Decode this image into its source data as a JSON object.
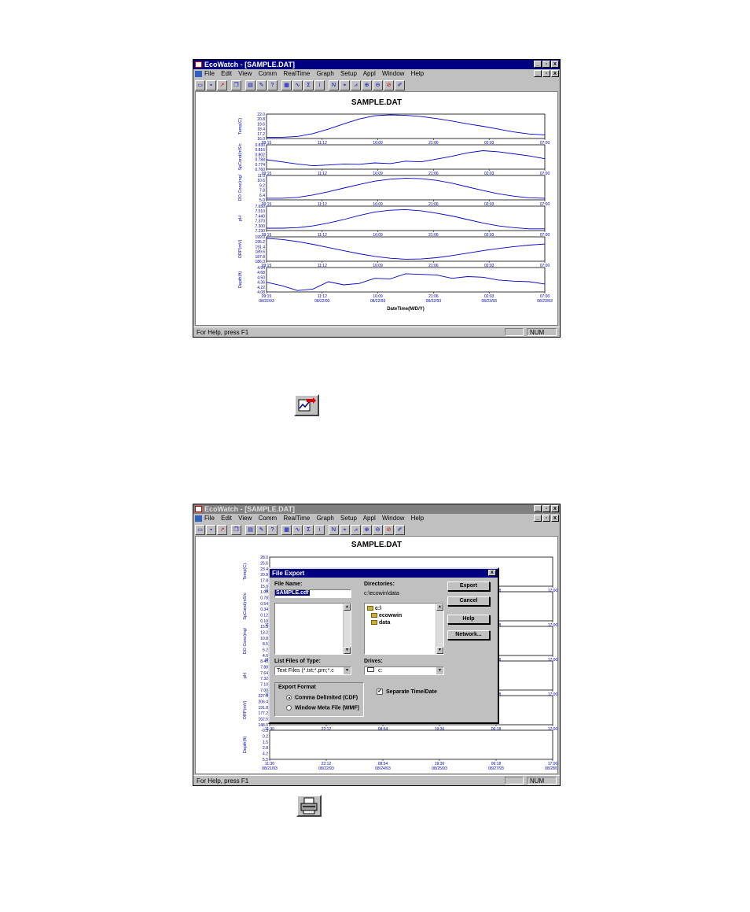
{
  "app": {
    "title": "EcoWatch - [SAMPLE.DAT]",
    "menu": [
      "File",
      "Edit",
      "View",
      "Comm",
      "RealTime",
      "Graph",
      "Setup",
      "Appl",
      "Window",
      "Help"
    ],
    "status_text": "For Help, press F1",
    "status_num": "NUM"
  },
  "plot1": {
    "title": "SAMPLE.DAT",
    "xlabel": "DateTime(M/D/Y)",
    "time_ticks": [
      "09:15",
      "11:12",
      "16:09",
      "21:06",
      "02:03",
      "07:00"
    ],
    "date_ticks": [
      "08/22/93",
      "08/22/93",
      "08/22/93",
      "08/22/93",
      "08/23/93",
      "08/23/93"
    ],
    "panels": [
      {
        "label": "Temp(C)",
        "ticks": [
          "22.0",
          "20.8",
          "19.6",
          "18.4",
          "17.2",
          "16.0"
        ],
        "values": [
          16.3,
          16.3,
          16.5,
          17.2,
          18.3,
          19.6,
          20.8,
          21.6,
          21.8,
          21.7,
          21.4,
          20.9,
          20.3,
          19.6,
          19.0,
          18.3,
          17.6,
          17.1,
          16.9
        ]
      },
      {
        "label": "SpCond(mS/c",
        "ticks": [
          "0.830",
          "0.816",
          "0.802",
          "0.788",
          "0.774",
          "0.760"
        ],
        "values": [
          0.787,
          0.781,
          0.775,
          0.77,
          0.772,
          0.775,
          0.774,
          0.778,
          0.776,
          0.783,
          0.781,
          0.789,
          0.797,
          0.807,
          0.813,
          0.81,
          0.804,
          0.798,
          0.79
        ]
      },
      {
        "label": "DO Conc(mg/",
        "ticks": [
          "11.0",
          "10.6",
          "9.2",
          "7.8",
          "6.4",
          "5.0"
        ],
        "values": [
          5.4,
          5.4,
          5.6,
          6.2,
          7.0,
          7.9,
          8.8,
          9.6,
          10.1,
          10.3,
          10.2,
          9.8,
          9.1,
          8.2,
          7.3,
          6.5,
          5.9,
          5.5,
          5.4
        ]
      },
      {
        "label": "pH",
        "ticks": [
          "7.650",
          "7.510",
          "7.440",
          "7.370",
          "7.300",
          "7.230"
        ],
        "values": [
          7.27,
          7.27,
          7.28,
          7.31,
          7.36,
          7.42,
          7.49,
          7.55,
          7.58,
          7.59,
          7.57,
          7.53,
          7.48,
          7.42,
          7.36,
          7.31,
          7.28,
          7.26,
          7.26
        ]
      },
      {
        "label": "ORP(mV)",
        "ticks": [
          "199.0",
          "195.2",
          "191.4",
          "189.6",
          "187.8",
          "186.0"
        ],
        "values": [
          198.2,
          197.6,
          196.5,
          195.0,
          193.3,
          191.6,
          190.0,
          188.6,
          187.6,
          187.1,
          187.2,
          187.9,
          189.0,
          190.3,
          191.6,
          192.8,
          193.8,
          194.6,
          195.2
        ]
      },
      {
        "label": "Depth(ft)",
        "ticks": [
          "4.94",
          "4.68",
          "4.50",
          "4.36",
          "4.22",
          "4.08"
        ],
        "values": [
          4.42,
          4.3,
          4.13,
          4.18,
          4.44,
          4.33,
          4.38,
          4.56,
          4.54,
          4.72,
          4.7,
          4.68,
          4.56,
          4.62,
          4.6,
          4.5,
          4.46,
          4.44,
          4.36
        ]
      }
    ]
  },
  "plot2": {
    "title": "SAMPLE.DAT",
    "xlabel": "DateTime(M/D/Y)",
    "time_ticks": [
      "11:30",
      "22:12",
      "08:54",
      "19:36",
      "06:18",
      "17:00"
    ],
    "date_ticks": [
      "08/21/93",
      "08/22/93",
      "08/24/93",
      "08/25/93",
      "08/27/93",
      "08/28/93"
    ],
    "panels": [
      {
        "label": "Temp(C)",
        "ticks": [
          "28.0",
          "25.6",
          "23.4",
          "20.8",
          "17.8",
          "15.0"
        ]
      },
      {
        "label": "SpCond(mS/c",
        "ticks": [
          "1.00",
          "0.78",
          "0.54",
          "0.34",
          "0.12",
          "0.10"
        ]
      },
      {
        "label": "DO Conc(mg/",
        "ticks": [
          "15.5",
          "13.2",
          "10.8",
          "8.5",
          "6.2",
          "4.0"
        ]
      },
      {
        "label": "pH",
        "ticks": [
          "8.40",
          "7.88",
          "7.64",
          "7.32",
          "7.10",
          "7.00"
        ]
      },
      {
        "label": "ORP(mV)",
        "ticks": [
          "227.0",
          "206.4",
          "191.8",
          "177.2",
          "162.6",
          "148.0"
        ]
      },
      {
        "label": "Depth(ft)",
        "ticks": [
          "-0.3",
          "0.2",
          "1.5",
          "2.8",
          "4.2",
          "5.5"
        ]
      }
    ]
  },
  "dialog": {
    "title": "File Export",
    "file_name_label": "File Name:",
    "file_name_value": "SAMPLE.cdf",
    "directories_label": "Directories:",
    "directory_path": "c:\\ecowin\\data",
    "dir_items": [
      "c:\\",
      "ecowwin",
      "data"
    ],
    "list_type_label": "List Files of Type:",
    "list_type_value": "Text Files (*.txt;*.prn;*.c",
    "drives_label": "Drives:",
    "drives_value": "c:",
    "export_format_label": "Export Format",
    "format_cdf": "Comma Delimited (CDF)",
    "format_wmf": "Window Meta File (WMF)",
    "separate_label": "Separate Time/Date",
    "btn_export": "Export",
    "btn_cancel": "Cancel",
    "btn_help": "Help",
    "btn_network": "Network..."
  },
  "icons": {
    "export_icon": "graph-export-icon",
    "print_icon": "printer-icon"
  }
}
